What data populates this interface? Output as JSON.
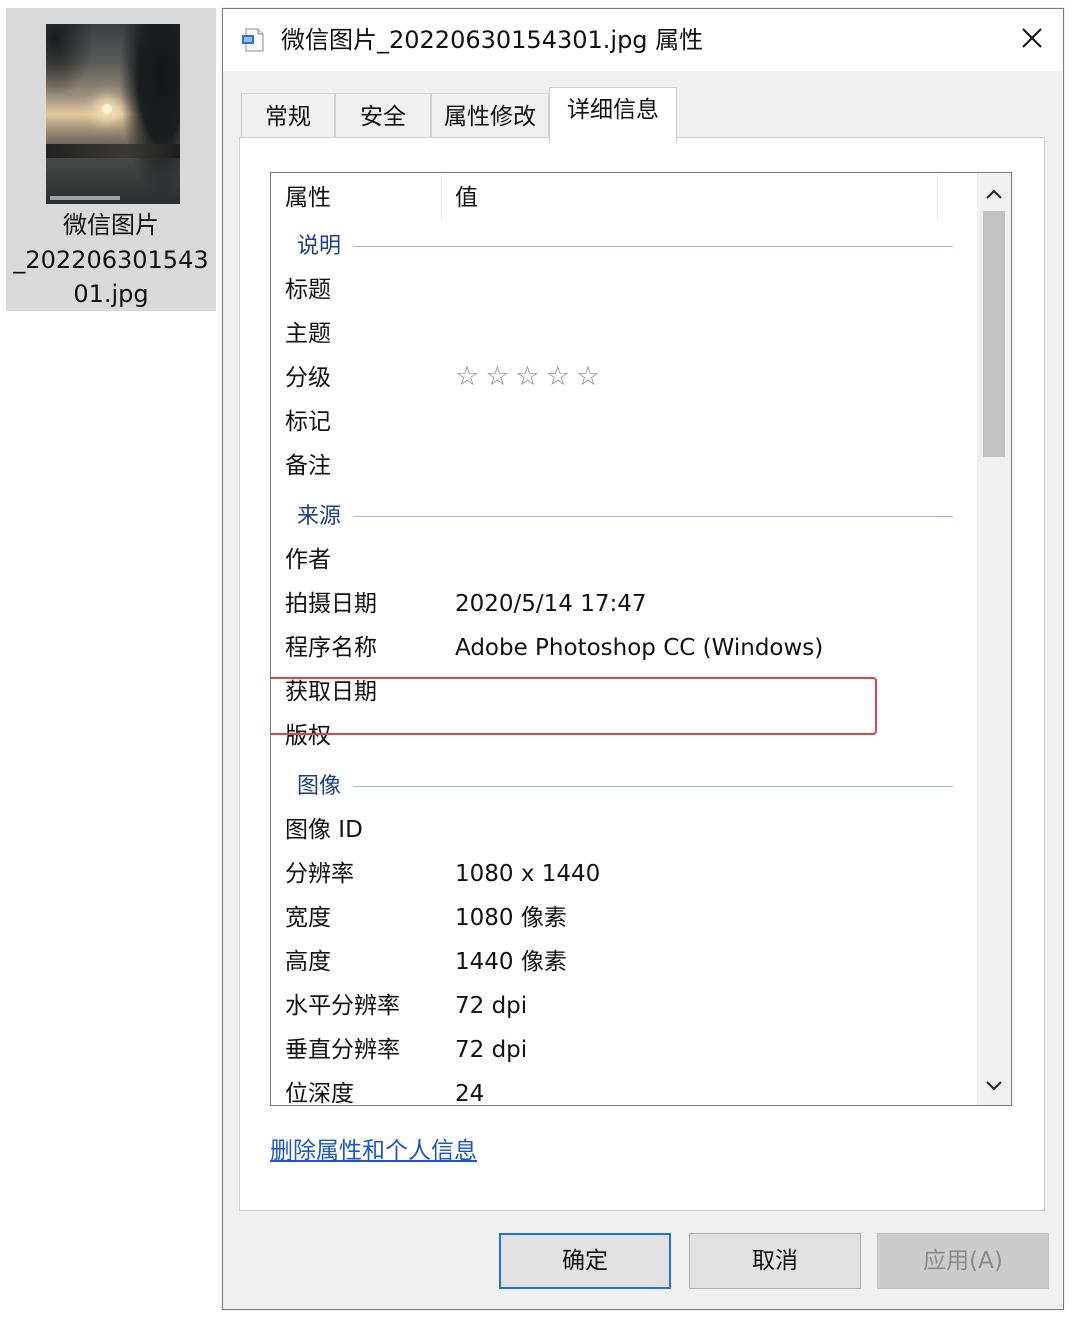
{
  "desktop_file": {
    "name_lines": [
      "微信图片",
      "_202206301543",
      "01.jpg"
    ]
  },
  "dialog": {
    "title": "微信图片_20220630154301.jpg 属性",
    "close_icon": "close-icon",
    "tabs": [
      {
        "label": "常规",
        "active": false
      },
      {
        "label": "安全",
        "active": false
      },
      {
        "label": "属性修改",
        "active": false
      },
      {
        "label": "详细信息",
        "active": true
      }
    ],
    "list": {
      "header": {
        "col1": "属性",
        "col2": "值"
      },
      "groups": {
        "description": {
          "label": "说明",
          "rows": [
            {
              "key": "标题",
              "value": ""
            },
            {
              "key": "主题",
              "value": ""
            },
            {
              "key": "分级",
              "value": "☆☆☆☆☆"
            },
            {
              "key": "标记",
              "value": ""
            },
            {
              "key": "备注",
              "value": ""
            }
          ]
        },
        "source": {
          "label": "来源",
          "rows": [
            {
              "key": "作者",
              "value": ""
            },
            {
              "key": "拍摄日期",
              "value": "2020/5/14 17:47"
            },
            {
              "key": "程序名称",
              "value": "Adobe Photoshop CC (Windows)"
            },
            {
              "key": "获取日期",
              "value": ""
            },
            {
              "key": "版权",
              "value": ""
            }
          ]
        },
        "image": {
          "label": "图像",
          "rows": [
            {
              "key": "图像 ID",
              "value": ""
            },
            {
              "key": "分辨率",
              "value": "1080 x 1440"
            },
            {
              "key": "宽度",
              "value": "1080 像素"
            },
            {
              "key": "高度",
              "value": "1440 像素"
            },
            {
              "key": "水平分辨率",
              "value": "72 dpi"
            },
            {
              "key": "垂直分辨率",
              "value": "72 dpi"
            },
            {
              "key": "位深度",
              "value": "24"
            }
          ]
        }
      },
      "highlight_color": "#e0424a"
    },
    "remove_link": "删除属性和个人信息",
    "buttons": {
      "ok": "确定",
      "cancel": "取消",
      "apply": "应用(A)"
    }
  }
}
